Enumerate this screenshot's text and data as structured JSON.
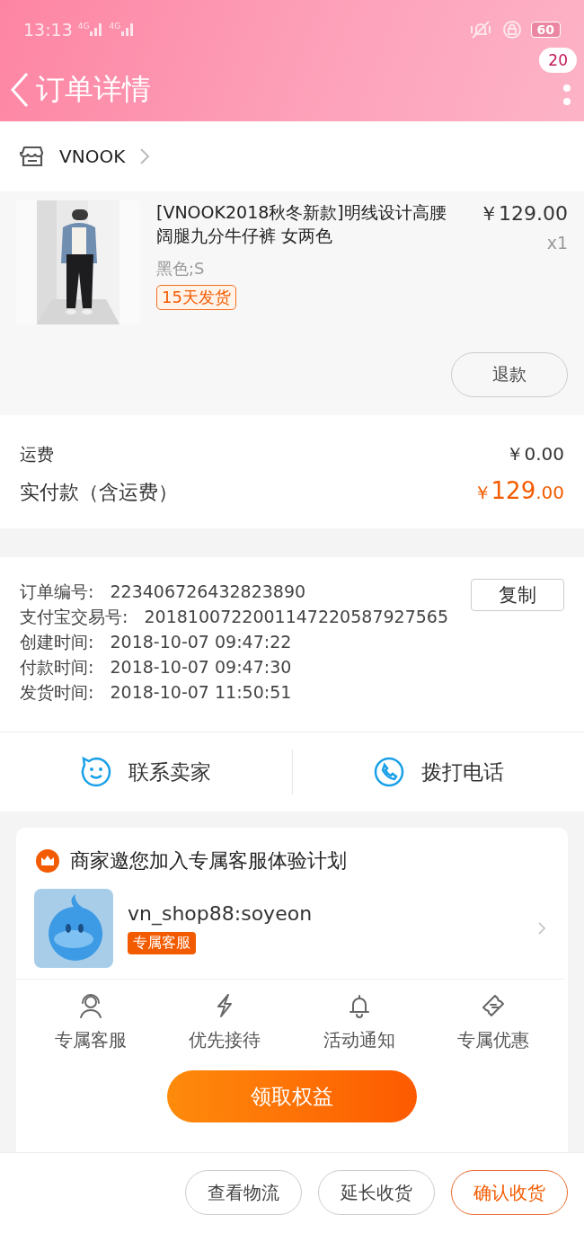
{
  "status_bar": {
    "time": "13:13",
    "network_1": "4G",
    "network_2": "4G",
    "battery": "60"
  },
  "header": {
    "title": "订单详情",
    "badge": "20"
  },
  "shop": {
    "name": "VNOOK"
  },
  "product": {
    "title": "[VNOOK2018秋冬新款]明线设计高腰阔腿九分牛仔裤 女两色",
    "price": "￥129.00",
    "quantity": "x1",
    "variant": "黑色;S",
    "tag": "15天发货",
    "action": "退款"
  },
  "fees": [
    {
      "label": "运费",
      "value": "￥0.00",
      "kind": "plain"
    },
    {
      "label": "实付款（含运费）",
      "currency": "￥",
      "value": "129",
      "cents": ".00",
      "kind": "total"
    }
  ],
  "order_info": {
    "copy_button": "复制",
    "rows": [
      {
        "label": "订单编号:",
        "value": "223406726432823890"
      },
      {
        "label": "支付宝交易号:",
        "value": "2018100722001147220587927565"
      },
      {
        "label": "创建时间:",
        "value": "2018-10-07 09:47:22"
      },
      {
        "label": "付款时间:",
        "value": "2018-10-07 09:47:30"
      },
      {
        "label": "发货时间:",
        "value": "2018-10-07 11:50:51"
      }
    ]
  },
  "contact": [
    {
      "label": "联系卖家",
      "kind": "chat"
    },
    {
      "label": "拨打电话",
      "kind": "phone"
    }
  ],
  "service_card": {
    "title": "商家邀您加入专属客服体验计划",
    "account": "vn_shop88:soyeon",
    "account_tag": "专属客服",
    "benefits": [
      {
        "label": "专属客服",
        "kind": "agent"
      },
      {
        "label": "优先接待",
        "kind": "bolt"
      },
      {
        "label": "活动通知",
        "kind": "bell"
      },
      {
        "label": "专属优惠",
        "kind": "ticket"
      }
    ],
    "claim_button": "领取权益"
  },
  "bottom_actions": [
    {
      "label": "查看物流",
      "kind": "plain"
    },
    {
      "label": "延长收货",
      "kind": "plain"
    },
    {
      "label": "确认收货",
      "kind": "primary"
    }
  ]
}
